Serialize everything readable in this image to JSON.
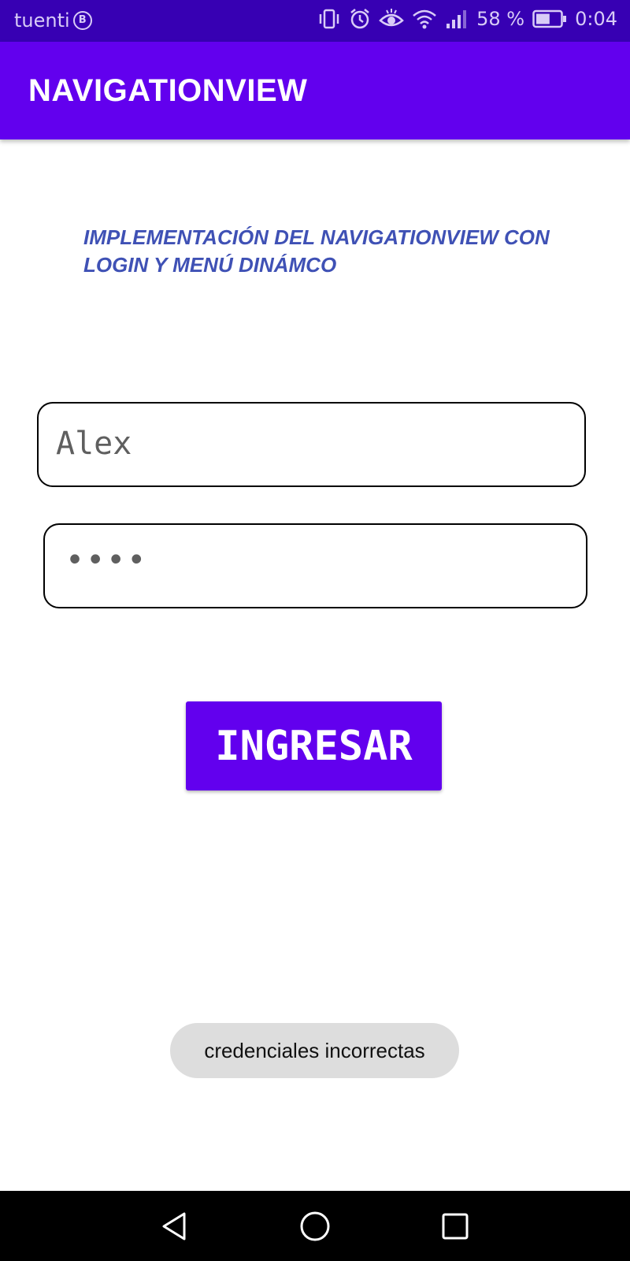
{
  "status_bar": {
    "carrier": "tuenti",
    "carrier_badge": "B",
    "battery_percent": "58 %",
    "battery_level": 0.58,
    "time": "0:04",
    "icons": [
      "vibrate-icon",
      "alarm-icon",
      "eye-icon",
      "wifi-icon",
      "signal-icon",
      "battery-icon"
    ],
    "color": "#3700b3"
  },
  "app_bar": {
    "title": "NAVIGATIONVIEW",
    "color": "#6200ee"
  },
  "main": {
    "heading": "IMPLEMENTACIÓN DEL NAVIGATIONVIEW CON LOGIN Y MENÚ DINÁMCO",
    "heading_color": "#3f51b5",
    "username_value": "Alex",
    "password_display": "••••",
    "login_button_label": "INGRESAR",
    "button_color": "#6200ee"
  },
  "toast": {
    "message": "credenciales incorrectas"
  },
  "nav_bar": {
    "icons": [
      "back-icon",
      "home-icon",
      "recents-icon"
    ]
  }
}
